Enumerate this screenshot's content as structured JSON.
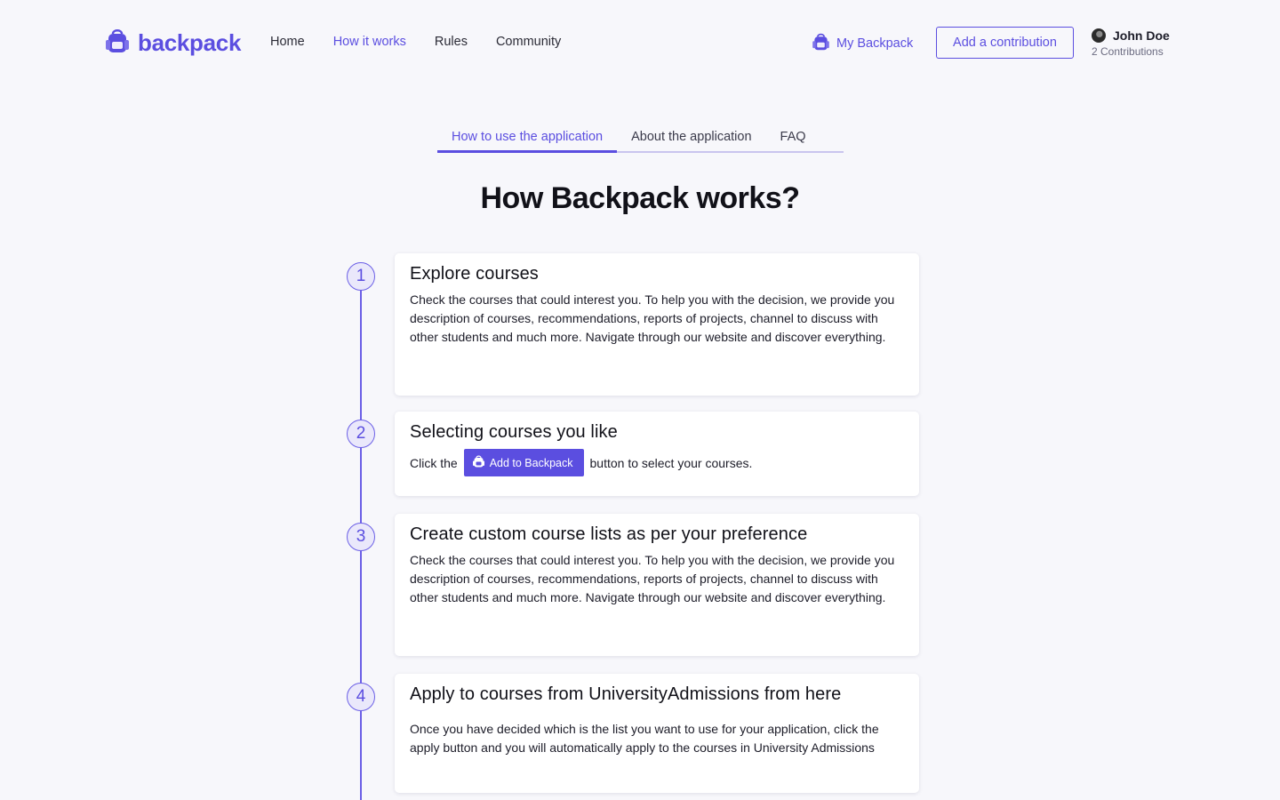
{
  "header": {
    "logo_text": "backpack",
    "nav": [
      {
        "label": "Home",
        "active": false
      },
      {
        "label": "How it works",
        "active": true
      },
      {
        "label": "Rules",
        "active": false
      },
      {
        "label": "Community",
        "active": false
      }
    ],
    "my_backpack_label": "My Backpack",
    "add_contribution_label": "Add a contribution",
    "user": {
      "name": "John Doe",
      "contributions": "2 Contributions"
    }
  },
  "tabs": [
    {
      "label": "How to use the application",
      "active": true
    },
    {
      "label": "About the application",
      "active": false
    },
    {
      "label": "FAQ",
      "active": false
    }
  ],
  "page_title": "How Backpack works?",
  "steps": [
    {
      "number": "1",
      "title": "Explore courses",
      "body": "Check the courses that could interest you. To help you with the decision, we provide you description of courses, recommendations, reports of projects, channel to discuss with other students and much more. Navigate through our website and discover everything."
    },
    {
      "number": "2",
      "title": "Selecting courses you like",
      "prefix": "Click the",
      "button_label": "Add to Backpack",
      "suffix": "button to select your courses."
    },
    {
      "number": "3",
      "title": "Create custom course lists as per your preference",
      "body": "Check the courses that could interest you. To help you with the decision, we provide you description of courses, recommendations, reports of projects, channel to discuss with other students and much more. Navigate through our website and discover everything."
    },
    {
      "number": "4",
      "title": "Apply to courses from UniversityAdmissions from here",
      "body": "Once you have decided which is the list you want to use for your application, click the apply button and you will automatically apply to the courses in University Admissions"
    }
  ],
  "colors": {
    "accent": "#5b4ee0",
    "background": "#f7f7fb",
    "step_circle_bg": "#eae8fb"
  },
  "icons": {
    "logo": "backpack-icon",
    "my_backpack": "backpack-icon",
    "user": "avatar"
  }
}
